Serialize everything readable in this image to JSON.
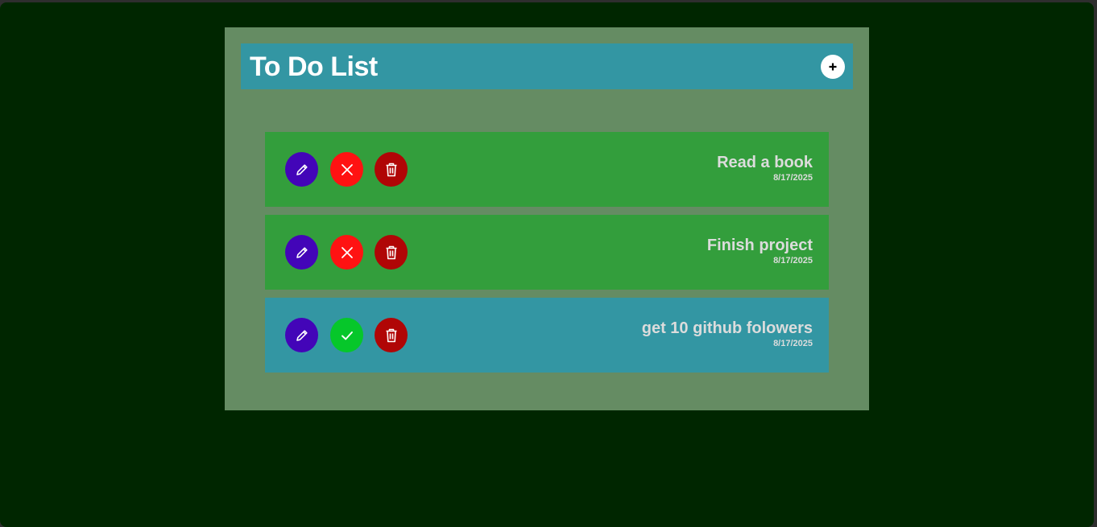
{
  "header": {
    "title": "To Do List",
    "add_icon": "plus-icon"
  },
  "colors": {
    "background": "#002600",
    "panel": "#658c63",
    "header": "#3396a3",
    "task_completed": "#339e3c",
    "task_pending": "#3396a3",
    "edit_button": "#4305b8",
    "undo_button": "#ff1212",
    "complete_button": "#06c72a",
    "delete_button": "#b00606"
  },
  "tasks": [
    {
      "name": "Read a book",
      "date": "8/17/2025",
      "status": "completed",
      "edit_icon": "pencil-icon",
      "toggle_icon": "x-icon",
      "delete_icon": "trash-icon"
    },
    {
      "name": "Finish project",
      "date": "8/17/2025",
      "status": "completed",
      "edit_icon": "pencil-icon",
      "toggle_icon": "x-icon",
      "delete_icon": "trash-icon"
    },
    {
      "name": "get 10 github folowers",
      "date": "8/17/2025",
      "status": "pending",
      "edit_icon": "pencil-icon",
      "toggle_icon": "check-icon",
      "delete_icon": "trash-icon"
    }
  ]
}
